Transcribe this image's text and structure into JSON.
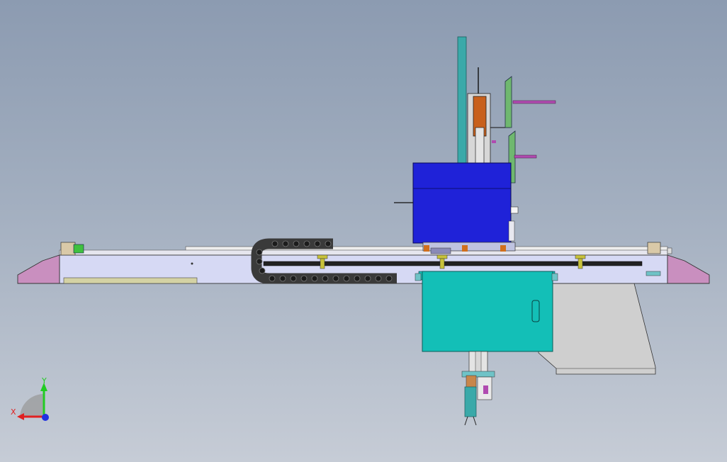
{
  "triad": {
    "x_label": "X",
    "y_label": "Y",
    "x_color": "#e02020",
    "y_color": "#22cc22",
    "z_color": "#2030e0"
  },
  "colors": {
    "beam": "#d6d9f4",
    "beam_end_caps": "#c98fbf",
    "drag_chain": "#3a3a3a",
    "motor_housing": "#1f22d8",
    "control_cabinet": "#13bfb7",
    "vertical_rod": "#3aa9a9",
    "counterweight_plate": "#cfcfcf",
    "gripper_arm": "#7aa3b4"
  }
}
